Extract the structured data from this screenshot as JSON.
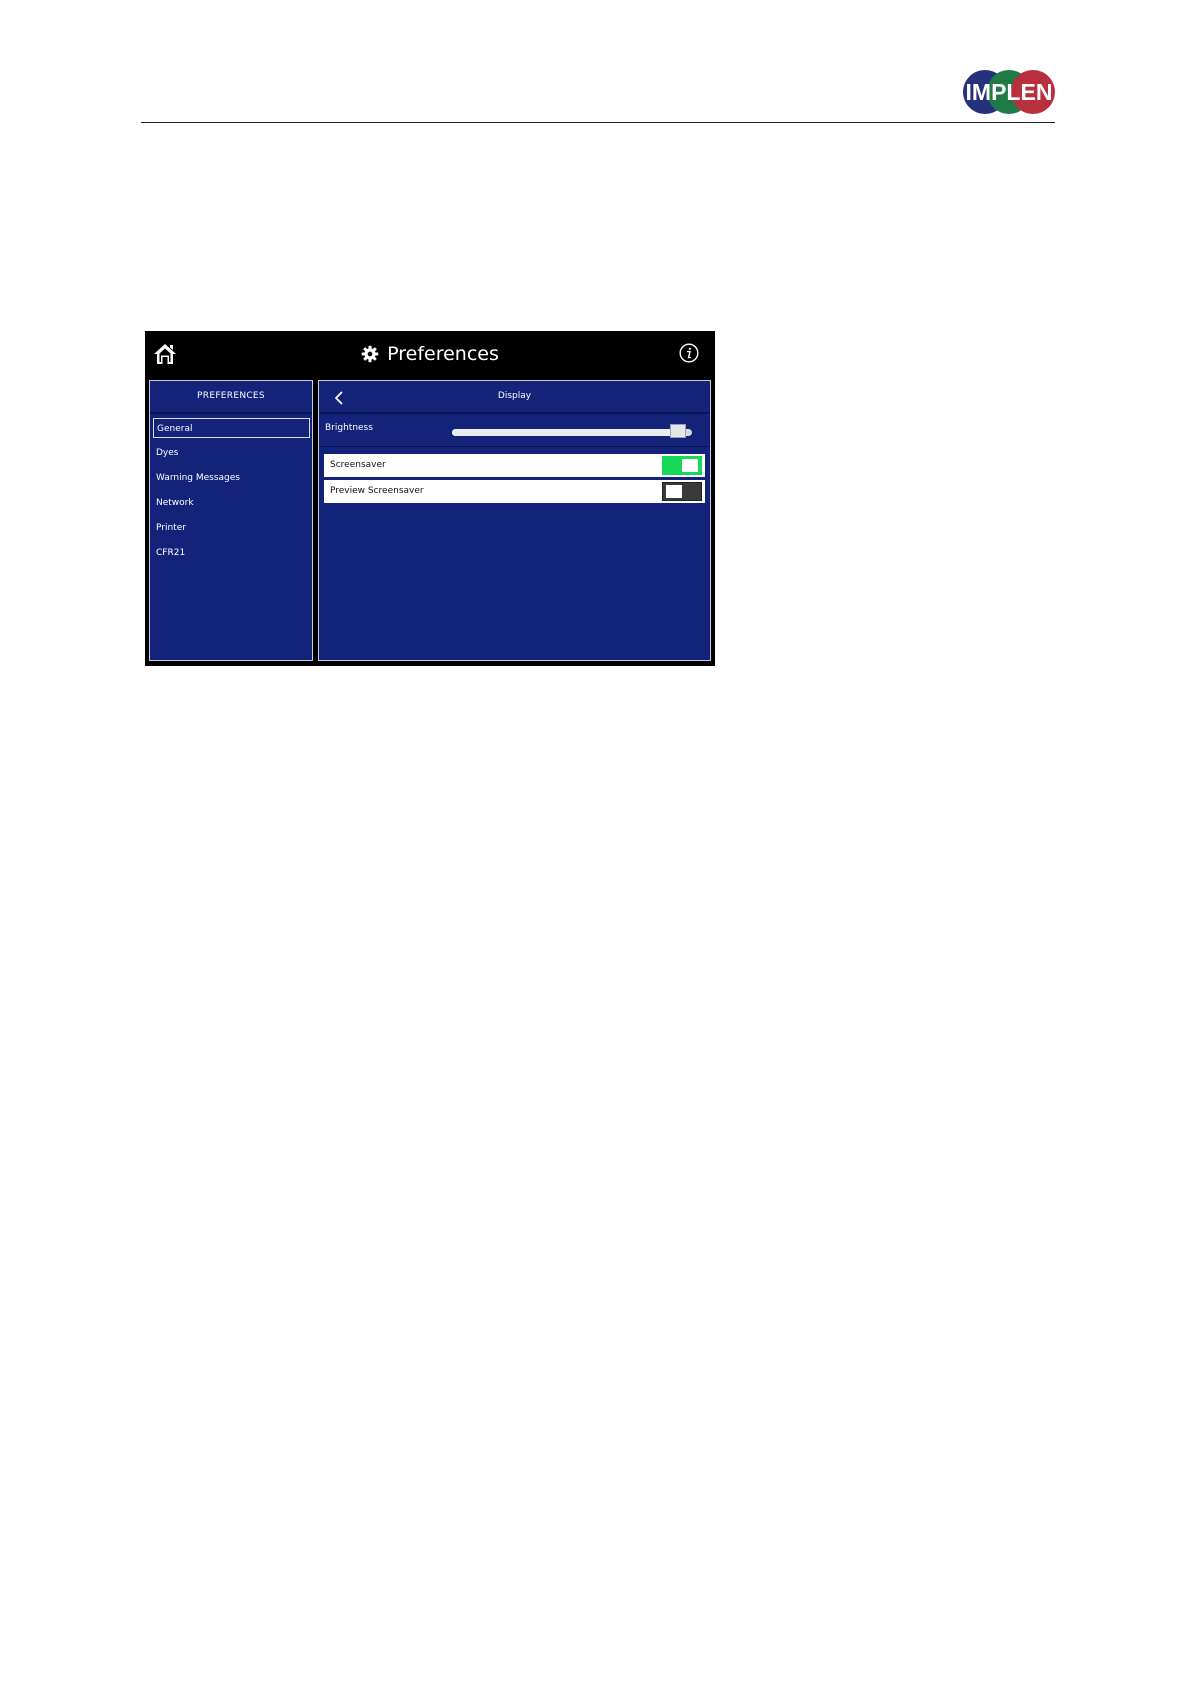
{
  "page_header": {
    "logo_text": "IMPLEN",
    "logo_colors": [
      "#27307a",
      "#1f7a45",
      "#b8303e"
    ]
  },
  "device": {
    "topbar": {
      "title": "Preferences",
      "left_icon": "home-icon",
      "title_icon": "gear-icon",
      "right_icon": "info-icon"
    },
    "sidebar": {
      "heading": "PREFERENCES",
      "items": [
        {
          "label": "General",
          "active": true
        },
        {
          "label": "Dyes",
          "active": false
        },
        {
          "label": "Warning Messages",
          "active": false
        },
        {
          "label": "Network",
          "active": false
        },
        {
          "label": "Printer",
          "active": false
        },
        {
          "label": "CFR21",
          "active": false
        }
      ]
    },
    "main": {
      "title": "Display",
      "back_icon": "chevron-left-icon",
      "brightness": {
        "label": "Brightness",
        "value_fraction": 0.94
      },
      "options": [
        {
          "label": "Screensaver",
          "enabled": true
        },
        {
          "label": "Preview Screensaver",
          "enabled": false
        }
      ]
    },
    "colors": {
      "panel_bg": "#13237a",
      "topbar_bg": "#000000",
      "toggle_on": "#18d957",
      "toggle_off": "#3a3a3a"
    }
  }
}
